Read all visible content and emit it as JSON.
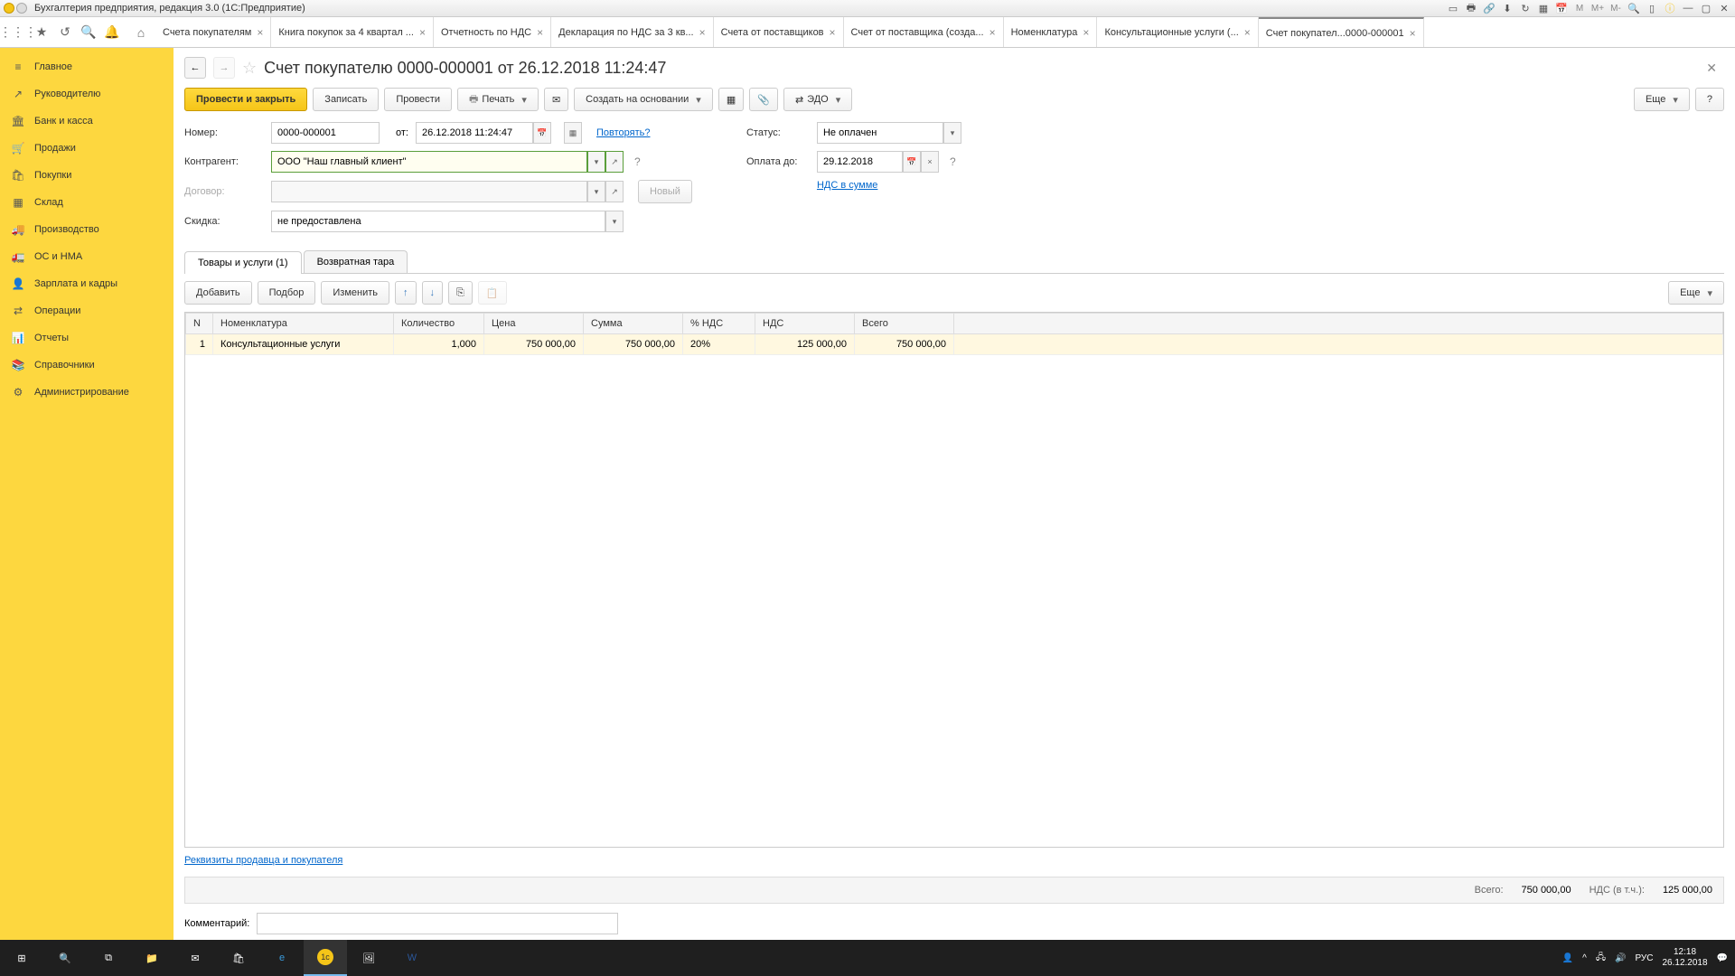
{
  "window": {
    "title": "Бухгалтерия предприятия, редакция 3.0  (1С:Предприятие)"
  },
  "tabs": [
    {
      "label": "Счета покупателям"
    },
    {
      "label": "Книга покупок за 4 квартал ..."
    },
    {
      "label": "Отчетность по НДС"
    },
    {
      "label": "Декларация по НДС за 3 кв..."
    },
    {
      "label": "Счета от поставщиков"
    },
    {
      "label": "Счет от поставщика (созда..."
    },
    {
      "label": "Номенклатура"
    },
    {
      "label": "Консультационные услуги (..."
    },
    {
      "label": "Счет покупател...0000-000001",
      "active": true
    }
  ],
  "sidebar": [
    {
      "label": "Главное",
      "icon": "≡"
    },
    {
      "label": "Руководителю",
      "icon": "↗"
    },
    {
      "label": "Банк и касса",
      "icon": "🏛"
    },
    {
      "label": "Продажи",
      "icon": "🛒"
    },
    {
      "label": "Покупки",
      "icon": "🛍"
    },
    {
      "label": "Склад",
      "icon": "▦"
    },
    {
      "label": "Производство",
      "icon": "🚚"
    },
    {
      "label": "ОС и НМА",
      "icon": "🚛"
    },
    {
      "label": "Зарплата и кадры",
      "icon": "👤"
    },
    {
      "label": "Операции",
      "icon": "⇄"
    },
    {
      "label": "Отчеты",
      "icon": "📊"
    },
    {
      "label": "Справочники",
      "icon": "📚"
    },
    {
      "label": "Администрирование",
      "icon": "⚙"
    }
  ],
  "doc": {
    "title": "Счет покупателю 0000-000001 от 26.12.2018 11:24:47",
    "toolbar": {
      "post_close": "Провести и закрыть",
      "write": "Записать",
      "post": "Провести",
      "print": "Печать",
      "create_based": "Создать на основании",
      "edo": "ЭДО",
      "more": "Еще",
      "help": "?"
    },
    "fields": {
      "number_label": "Номер:",
      "number": "0000-000001",
      "from_label": "от:",
      "date": "26.12.2018 11:24:47",
      "repeat": "Повторять?",
      "counterparty_label": "Контрагент:",
      "counterparty": "ООО \"Наш главный клиент\"",
      "contract_label": "Договор:",
      "new_btn": "Новый",
      "discount_label": "Скидка:",
      "discount": "не предоставлена",
      "status_label": "Статус:",
      "status": "Не оплачен",
      "payment_label": "Оплата до:",
      "payment_date": "29.12.2018",
      "vat_link": "НДС в сумме"
    },
    "subtabs": {
      "goods": "Товары и услуги (1)",
      "tare": "Возвратная тара"
    },
    "table_toolbar": {
      "add": "Добавить",
      "pick": "Подбор",
      "change": "Изменить",
      "more": "Еще"
    },
    "columns": {
      "n": "N",
      "nom": "Номенклатура",
      "qty": "Количество",
      "price": "Цена",
      "sum": "Сумма",
      "vat_pct": "% НДС",
      "vat": "НДС",
      "total": "Всего"
    },
    "rows": [
      {
        "n": "1",
        "nom": "Консультационные услуги",
        "qty": "1,000",
        "price": "750 000,00",
        "sum": "750 000,00",
        "vat_pct": "20%",
        "vat": "125 000,00",
        "total": "750 000,00"
      }
    ],
    "seller_link": "Реквизиты продавца и покупателя",
    "totals": {
      "label": "Всего:",
      "sum": "750 000,00",
      "vat_label": "НДС (в т.ч.):",
      "vat": "125 000,00"
    },
    "comment_label": "Комментарий:"
  },
  "taskbar": {
    "time": "12:18",
    "date": "26.12.2018",
    "lang": "РУС"
  }
}
